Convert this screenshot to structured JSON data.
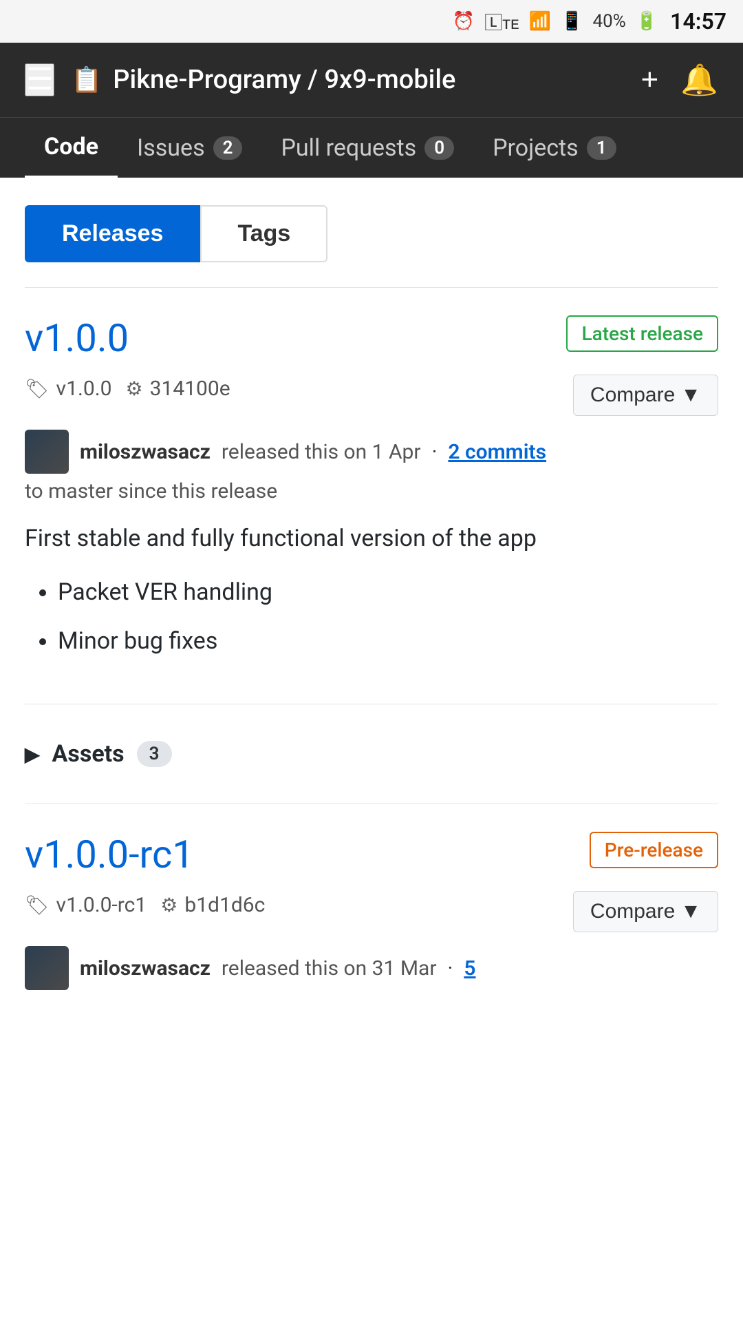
{
  "statusBar": {
    "battery": "40%",
    "time": "14:57",
    "icons": [
      "alarm",
      "lte",
      "wifi",
      "signal"
    ]
  },
  "navbar": {
    "repoIcon": "📋",
    "repoPath": "Pikne-Programy / 9x9-mobile",
    "addLabel": "+",
    "bellLabel": "🔔"
  },
  "tabs": [
    {
      "label": "Code",
      "badge": null,
      "active": true
    },
    {
      "label": "Issues",
      "badge": "2",
      "active": false
    },
    {
      "label": "Pull requests",
      "badge": "0",
      "active": false
    },
    {
      "label": "Projects",
      "badge": "1",
      "active": false
    }
  ],
  "toggle": {
    "releases": "Releases",
    "tags": "Tags"
  },
  "releases": [
    {
      "version": "v1.0.0",
      "badge": "Latest release",
      "badgeType": "latest",
      "tagLabel": "v1.0.0",
      "commitHash": "314100e",
      "author": "miloszwasacz",
      "releasedOn": "released this on 1 Apr",
      "commitsLink": "2 commits",
      "commitsMeta": "to master since this release",
      "compareLabel": "Compare",
      "bodyText": "First stable and fully functional version of the app",
      "listItems": [
        "Packet VER handling",
        "Minor bug fixes"
      ],
      "assetsLabel": "Assets",
      "assetsCount": "3"
    },
    {
      "version": "v1.0.0-rc1",
      "badge": "Pre-release",
      "badgeType": "prerelease",
      "tagLabel": "v1.0.0-rc1",
      "commitHash": "b1d1d6c",
      "author": "miloszwasacz",
      "releasedOn": "released this on 31 Mar",
      "commitsLink": "5",
      "commitsMeta": "",
      "compareLabel": "Compare",
      "bodyText": "",
      "listItems": [],
      "assetsLabel": "",
      "assetsCount": ""
    }
  ]
}
